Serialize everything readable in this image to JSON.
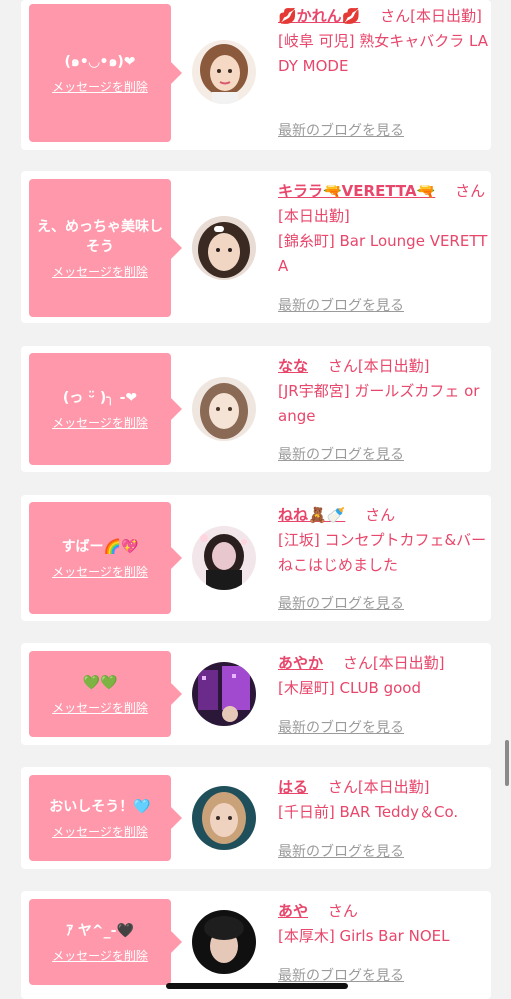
{
  "cards": [
    {
      "bubble_message": "(๑•◡•๑)❤",
      "delete_label": "メッセージを削除",
      "name": "💋かれん💋",
      "honorific": "さん",
      "status": "[本日出勤]",
      "location": "[岐阜 可児] 熟女キャバクラ LADY MODE",
      "blog_link": "最新のブログを見る",
      "avatar_icon": "illustrated-woman-avatar",
      "avatar_colors": [
        "#c89b7a",
        "#f6d9c4"
      ]
    },
    {
      "bubble_message": "え、めっちゃ美味しそう",
      "delete_label": "メッセージを削除",
      "name": "キララ🔫VERETTA🔫",
      "honorific": "さん",
      "status": "[本日出勤]",
      "location": "[錦糸町] Bar Lounge VERETTA",
      "blog_link": "最新のブログを見る",
      "avatar_icon": "woman-photo-avatar",
      "avatar_colors": [
        "#3a2a22",
        "#f2d6c4"
      ]
    },
    {
      "bubble_message": "(っ ᵕ̈ )╮ -❤",
      "delete_label": "メッセージを削除",
      "name": "なな",
      "honorific": "さん",
      "status": "[本日出勤]",
      "location": "[JR宇都宮] ガールズカフェ orange",
      "blog_link": "最新のブログを見る",
      "avatar_icon": "woman-photo-avatar",
      "avatar_colors": [
        "#8a6a55",
        "#f5e3d6"
      ]
    },
    {
      "bubble_message": "すばー🌈💖",
      "delete_label": "メッセージを削除",
      "name": "ねね🧸🍼",
      "honorific": "さん",
      "status": "",
      "location": "[江坂] コンセプトカフェ&バー　ねこはじめました",
      "blog_link": "最新のブログを見る",
      "avatar_icon": "woman-photo-avatar",
      "avatar_colors": [
        "#2a1e1e",
        "#e9c7cf"
      ]
    },
    {
      "bubble_message": "💚💚",
      "delete_label": "メッセージを削除",
      "name": "あやか",
      "honorific": "さん",
      "status": "[本日出勤]",
      "location": "[木屋町] CLUB good",
      "blog_link": "最新のブログを見る",
      "avatar_icon": "night-club-photo-avatar",
      "avatar_colors": [
        "#2b1838",
        "#a14ad0"
      ]
    },
    {
      "bubble_message": "おいしそう！🩵",
      "delete_label": "メッセージを削除",
      "name": "はる",
      "honorific": "さん",
      "status": "[本日出勤]",
      "location": "[千日前] BAR Teddy＆Co.",
      "blog_link": "最新のブログを見る",
      "avatar_icon": "woman-photo-avatar",
      "avatar_colors": [
        "#1f4f5a",
        "#f0d2c0"
      ]
    },
    {
      "bubble_message": "ｱ ヤ^_-🖤",
      "delete_label": "メッセージを削除",
      "name": "あや",
      "honorific": "さん",
      "status": "",
      "location": "[本厚木] Girls Bar NOEL",
      "blog_link": "最新のブログを見る",
      "avatar_icon": "woman-photo-avatar",
      "avatar_colors": [
        "#101010",
        "#e6c8b8"
      ]
    }
  ]
}
